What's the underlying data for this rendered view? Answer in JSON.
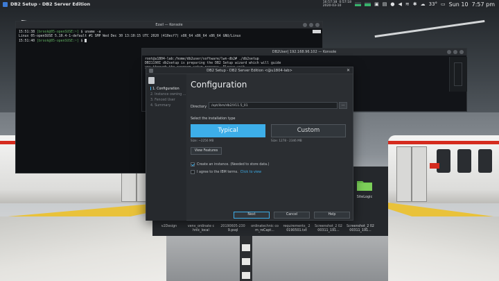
{
  "topbar": {
    "app_title": "DB2 Setup - DB2 Server Edition",
    "stat_time": "16:57:38",
    "stat_cpu": "0:57:18",
    "stat_date": "2020-03-10",
    "temperature": "33°",
    "day": "Sun 10",
    "time": "7:57 pm",
    "cpu_load": 0.45,
    "mem_load": 0.6
  },
  "konsole": {
    "title": "Ezail — Konsole",
    "lines": [
      {
        "time": "15:51:38",
        "user": "[brook@05-openSUSE:~]",
        "cmd": "$ uname -a"
      },
      {
        "time": "",
        "user": "",
        "cmd": "Linux 05-openSUSE 5.10.4-1-default #1 SMP Wed Dec 30 13:10:15 UTC 2020 (410ecf7) x86_64 x86_64 x86_64 GNU/Linux"
      },
      {
        "time": "15:51:40",
        "user": "[brook@05-openSUSE:~]",
        "cmd": "$"
      }
    ]
  },
  "konsole2": {
    "title": "DB2User| 192.168.96.102 — Konsole",
    "lines": [
      "root@u1804-lab:/home/db2user/software/lwn-db2# ./db2setup",
      "DBI1190I  db2setup is preparing the DB2 Setup wizard which will guide",
      "          you through the program setup process. Please wait."
    ]
  },
  "dialog": {
    "title": "DB2 Setup - DB2 Server Edition <@u1804-lab>",
    "steps": [
      "1. Configuration",
      "2. Instance owning ...",
      "3. Fenced User",
      "4. Summary"
    ],
    "heading": "Configuration",
    "directory_label": "Directory",
    "directory_value": "/opt/ibm/db2/V11.5_01",
    "browse_label": "...",
    "install_type_label": "Select the installation type",
    "typical_label": "Typical",
    "custom_label": "Custom",
    "typical_size": "Size: ~2256 MB",
    "custom_size": "Size: 1278 - 2346 MB",
    "view_features_label": "View Features",
    "create_instance_label": "Create an instance. (Needed to store data.)",
    "create_instance_checked": true,
    "terms_label": "I agree to the IBM terms.",
    "terms_link": "Click to view",
    "terms_checked": false,
    "next_label": "Next",
    "cancel_label": "Cancel",
    "help_label": "Help"
  },
  "files": {
    "items": [
      "v2Design",
      "venv_ordinate chnic_local",
      "20190605-230 9.psql",
      "ordinatechnic com_reCapt...",
      "requirements_ 20190501.txt",
      "Screenshot_2 0200311_191...",
      "Screenshot_2 0200311_191..."
    ],
    "folder_label": "SiteLogic",
    "folder_color": "#6abf4b"
  }
}
